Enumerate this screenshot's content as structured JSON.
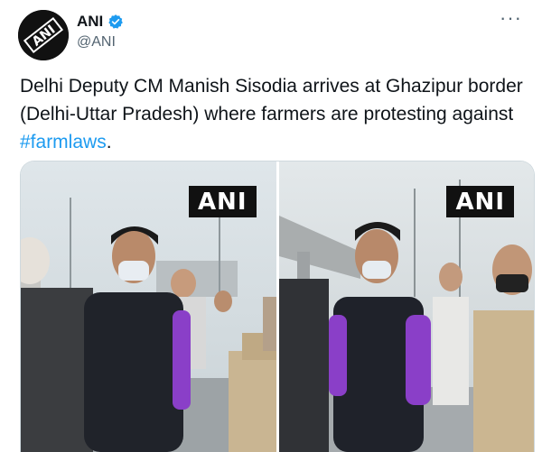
{
  "account": {
    "name": "ANI",
    "handle": "@ANI",
    "avatar_text": "ANI",
    "verified": true,
    "icons": {
      "verified": "verified-badge-icon",
      "more": "more-options-icon"
    }
  },
  "tweet": {
    "text_before": "Delhi Deputy CM Manish Sisodia arrives at Ghazipur border (Delhi-Uttar Pradesh) where farmers are protesting against ",
    "hashtag": "#farmlaws",
    "text_after": "."
  },
  "media": {
    "photos": [
      {
        "watermark": "ANI"
      },
      {
        "watermark": "ANI"
      }
    ]
  },
  "colors": {
    "link": "#1d9bf0",
    "verified": "#1d9bf0",
    "muted": "#536471",
    "purple_shirt": "#8a3fc8"
  }
}
